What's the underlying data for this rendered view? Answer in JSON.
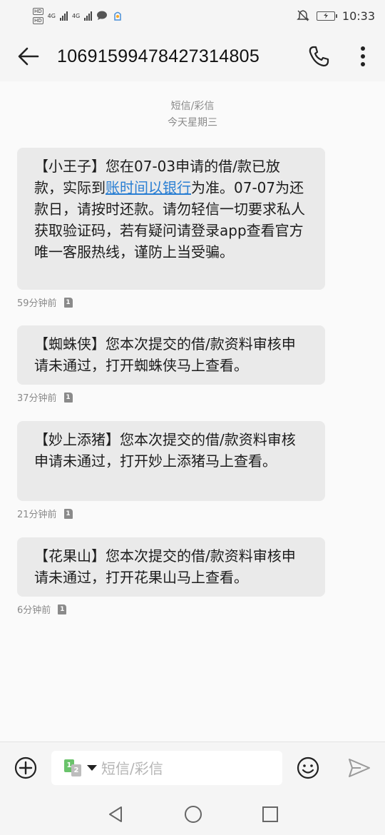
{
  "status_bar": {
    "sim1_badge": "HD",
    "sim2_badge": "HD",
    "network1": "4G",
    "network2": "4G",
    "time": "10:33"
  },
  "header": {
    "title": "10691599478427314805"
  },
  "thread": {
    "type_label": "短信/彩信",
    "date_label": "今天星期三"
  },
  "messages": [
    {
      "text_before_link": "【小王子】您在07-03申请的借/款已放款，实际到",
      "link_text": "账时间以银行",
      "text_after_link": "为准。07-07为还款日，请按时还款。请勿轻信一切要求私人获取验证码，若有疑问请登录app查看官方唯一客服热线，谨防上当受骗。",
      "time": "59分钟前",
      "sim": "1"
    },
    {
      "text": "【蜘蛛侠】您本次提交的借/款资料审核申请未通过，打开蜘蛛侠马上查看。",
      "time": "37分钟前",
      "sim": "1"
    },
    {
      "text": "【妙上添猪】您本次提交的借/款资料审核申请未通过，打开妙上添猪马上查看。",
      "time": "21分钟前",
      "sim": "1"
    },
    {
      "text": "【花果山】您本次提交的借/款资料审核申请未通过，打开花果山马上查看。",
      "time": "6分钟前",
      "sim": "1"
    }
  ],
  "composer": {
    "sim_primary": "1",
    "sim_secondary": "2",
    "placeholder": "短信/彩信"
  },
  "colors": {
    "bubble_bg": "#eaeaea",
    "link": "#2a7fd3",
    "sim_green": "#6ac36b",
    "meta_gray": "#8a8a8a"
  },
  "icons": {
    "back": "back-arrow-icon",
    "call": "phone-icon",
    "more": "more-vertical-icon",
    "add": "add-circle-icon",
    "emoji": "emoji-icon",
    "send": "send-icon",
    "nav_back": "nav-back-icon",
    "nav_home": "nav-home-icon",
    "nav_recent": "nav-recent-icon"
  }
}
